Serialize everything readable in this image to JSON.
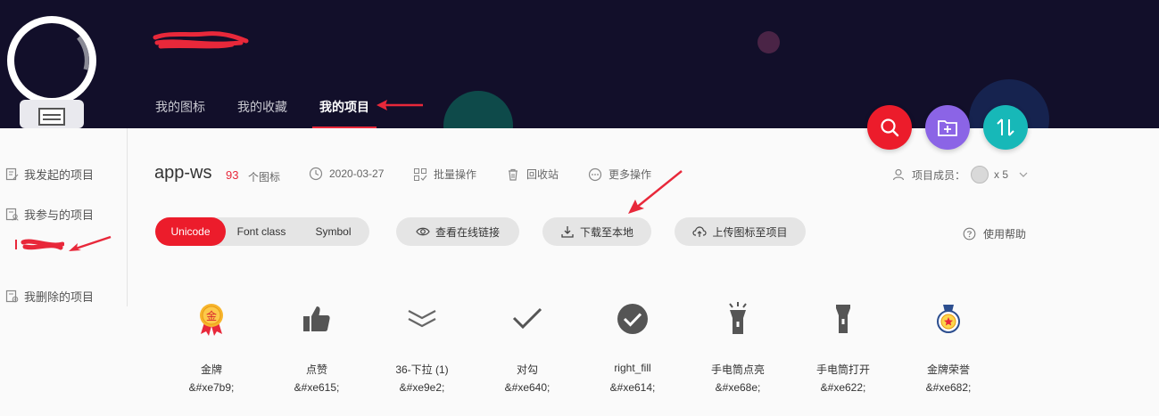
{
  "nav": {
    "items": [
      "我的图标",
      "我的收藏",
      "我的项目"
    ],
    "active_index": 2
  },
  "sidebar": {
    "items": [
      "我发起的项目",
      "我参与的项目",
      "我删除的项目"
    ]
  },
  "project": {
    "name": "app-ws",
    "icon_count": "93",
    "icon_count_label": "个图标",
    "date": "2020-03-27",
    "batch_label": "批量操作",
    "recycle_label": "回收站",
    "more_label": "更多操作",
    "members_label": "项目成员：",
    "members_count": "x 5"
  },
  "toolbar": {
    "segments": [
      "Unicode",
      "Font class",
      "Symbol"
    ],
    "active_segment": "Unicode",
    "view_link_label": "查看在线链接",
    "download_label": "下载至本地",
    "upload_label": "上传图标至项目",
    "help_label": "使用帮助"
  },
  "icons": [
    {
      "name": "金牌",
      "code": "&#xe7b9;",
      "icon": "gold-medal-icon"
    },
    {
      "name": "点赞",
      "code": "&#xe615;",
      "icon": "thumbs-up-icon"
    },
    {
      "name": "36-下拉 (1)",
      "code": "&#xe9e2;",
      "icon": "double-chevron-down-icon"
    },
    {
      "name": "对勾",
      "code": "&#xe640;",
      "icon": "check-icon"
    },
    {
      "name": "right_fill",
      "code": "&#xe614;",
      "icon": "check-circle-fill-icon"
    },
    {
      "name": "手电筒点亮",
      "code": "&#xe68e;",
      "icon": "flashlight-on-icon"
    },
    {
      "name": "手电筒打开",
      "code": "&#xe622;",
      "icon": "flashlight-icon"
    },
    {
      "name": "金牌荣誉",
      "code": "&#xe682;",
      "icon": "honor-medal-icon"
    }
  ],
  "colors": {
    "header_bg": "#120f2a",
    "accent": "#ec1c2b",
    "purple": "#8b64e6",
    "teal": "#17b8b8"
  }
}
